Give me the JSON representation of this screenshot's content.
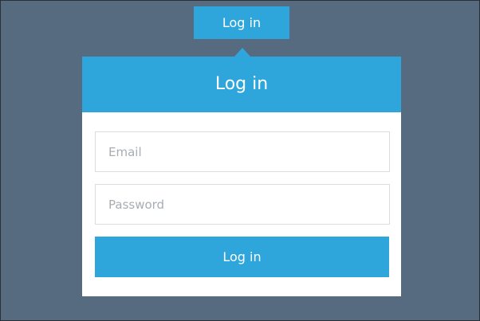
{
  "toggle": {
    "label": "Log in"
  },
  "panel": {
    "title": "Log in",
    "email_placeholder": "Email",
    "password_placeholder": "Password",
    "submit_label": "Log in"
  },
  "colors": {
    "background": "#576b80",
    "accent": "#2ea6dc",
    "panel": "#ffffff",
    "border": "#d9dde1",
    "placeholder": "#a7adb3"
  }
}
